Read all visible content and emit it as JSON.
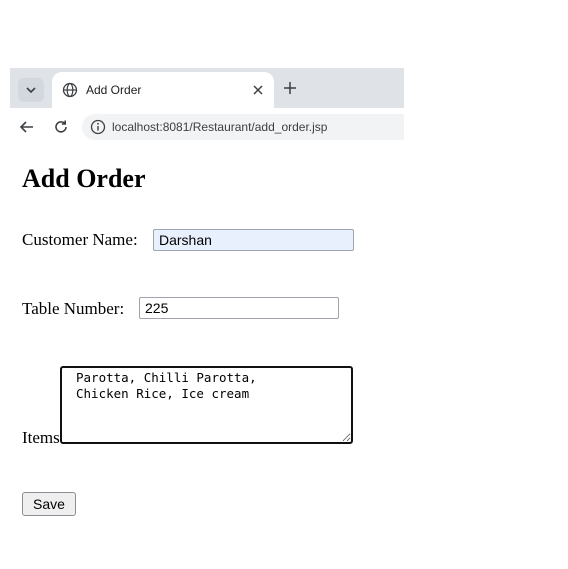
{
  "tab": {
    "title": "Add Order"
  },
  "address_bar": {
    "url": "localhost:8081/Restaurant/add_order.jsp"
  },
  "page": {
    "heading": "Add Order",
    "customer_name_label": "Customer Name:",
    "customer_name_value": "Darshan",
    "table_number_label": "Table Number:",
    "table_number_value": "225",
    "items_label": "Items:",
    "items_value": "Parotta, Chilli Parotta,\nChicken Rice, Ice cream",
    "save_label": "Save"
  },
  "colors": {
    "tabbar_bg": "#dfe3e8",
    "autofill_bg": "#e8f0fe",
    "address_bg": "#f1f3f4"
  },
  "icons": [
    "chevron-down-icon",
    "globe-icon",
    "close-icon",
    "plus-icon",
    "back-arrow-icon",
    "reload-icon",
    "info-icon"
  ]
}
